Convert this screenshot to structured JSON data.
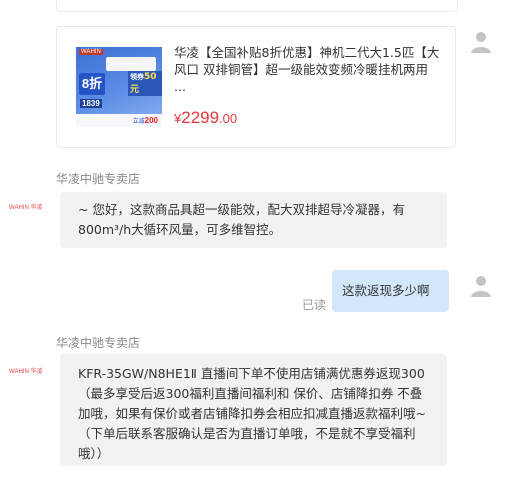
{
  "product": {
    "title": "华凌【全国补贴8折优惠】神机二代大1.5匹【大风口 双排铜管】超一级能效变频冷暖挂机两用 ...",
    "price_symbol": "¥",
    "price_integer": "2299",
    "price_decimal": ".00",
    "image": {
      "brand": "WAHIN",
      "discount": "8折",
      "price": "1839",
      "badge_prefix": "领券",
      "badge_value": "50元",
      "bottom_prefix": "立减",
      "bottom_value": "200"
    }
  },
  "messages": [
    {
      "sender": "华凌中驰专卖店",
      "avatar_text": "WAHIN 华凌",
      "text": "~ 您好，这款商品具超一级能效，配大双排超导冷凝器，有800m³/h大循环风量，可多维智控。"
    },
    {
      "text": "这款返现多少啊",
      "status": "已读"
    },
    {
      "sender": "华凌中驰专卖店",
      "avatar_text": "WAHIN 华凌",
      "text": "KFR-35GW/N8HE1Ⅱ 直播间下单不使用店铺满优惠券返现300（最多享受后返300福利直播间福利和 保价、店铺降扣券 不叠加哦，如果有保价或者店铺降扣券会相应扣减直播返款福利哦~ （下单后联系客服确认是否为直播订单哦，不是就不享受福利哦））"
    }
  ],
  "colors": {
    "price_red": "#e4393c",
    "user_bubble": "#d3e7fb",
    "shop_bubble": "#f2f2f2",
    "muted_text": "#999999"
  }
}
